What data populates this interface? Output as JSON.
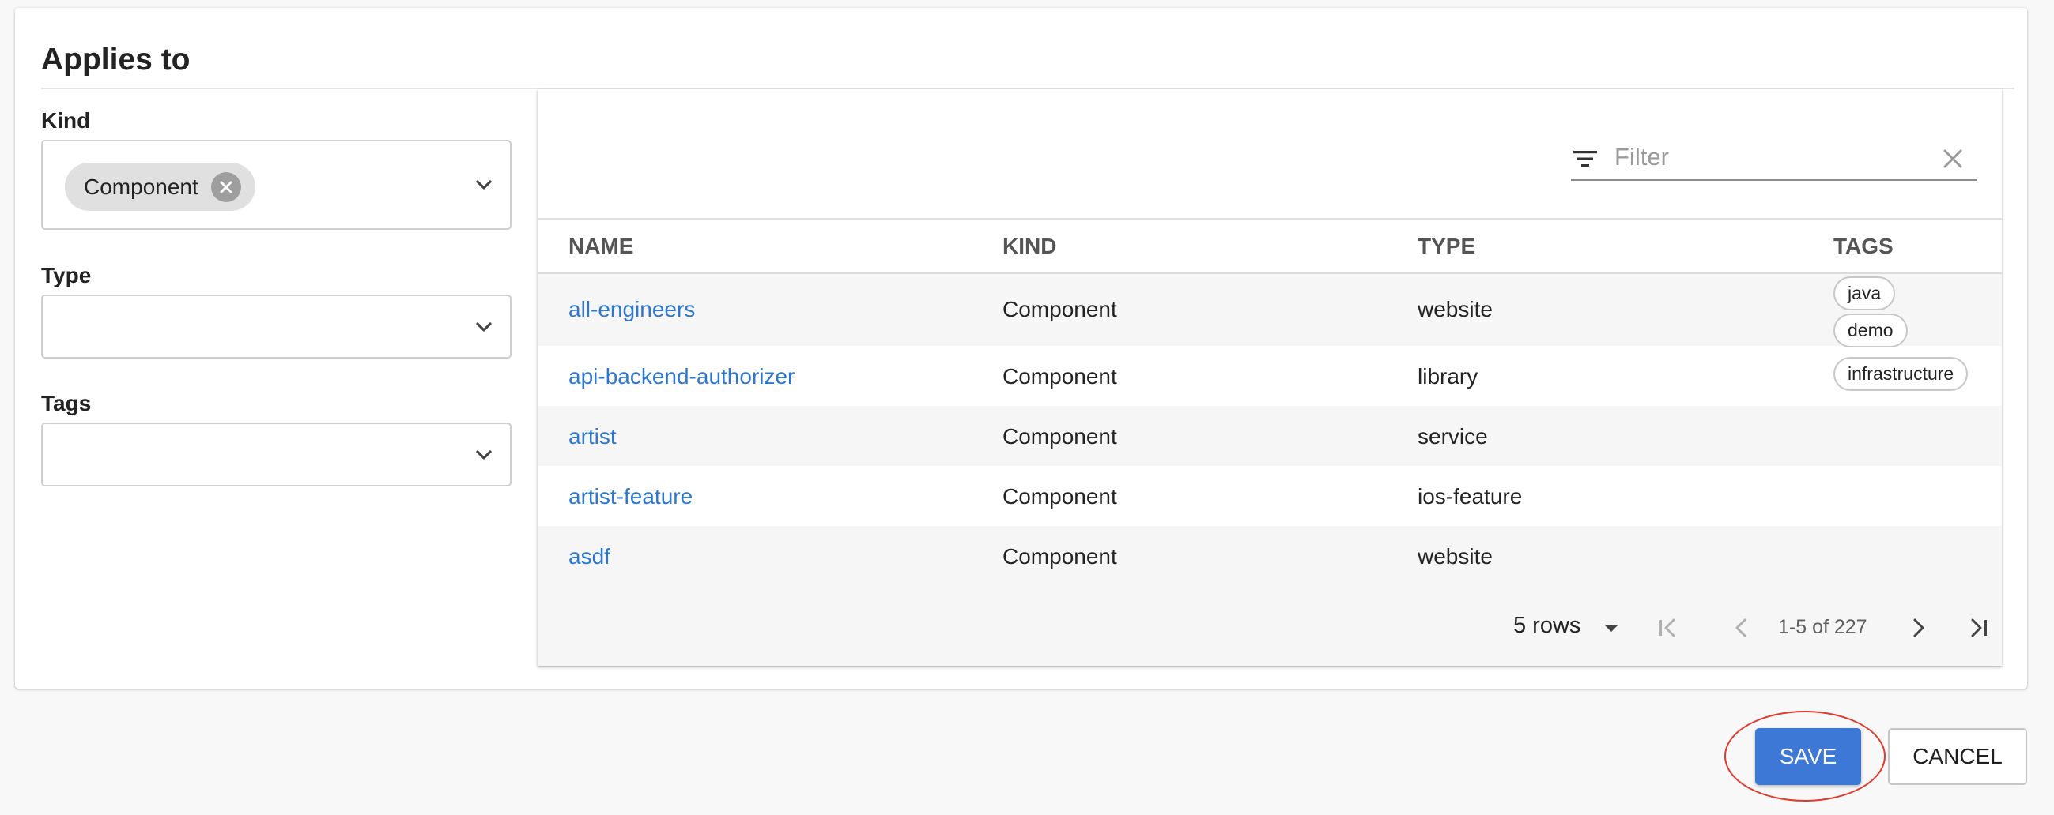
{
  "card": {
    "title": "Applies to"
  },
  "filters": {
    "kind": {
      "label": "Kind",
      "chip": "Component"
    },
    "type": {
      "label": "Type"
    },
    "tags": {
      "label": "Tags"
    }
  },
  "table": {
    "search": {
      "placeholder": "Filter",
      "value": ""
    },
    "columns": [
      "NAME",
      "KIND",
      "TYPE",
      "TAGS"
    ],
    "rows": [
      {
        "name": "all-engineers",
        "kind": "Component",
        "type": "website",
        "tags": [
          "java",
          "demo"
        ]
      },
      {
        "name": "api-backend-authorizer",
        "kind": "Component",
        "type": "library",
        "tags": [
          "infrastructure"
        ]
      },
      {
        "name": "artist",
        "kind": "Component",
        "type": "service",
        "tags": []
      },
      {
        "name": "artist-feature",
        "kind": "Component",
        "type": "ios-feature",
        "tags": []
      },
      {
        "name": "asdf",
        "kind": "Component",
        "type": "website",
        "tags": []
      }
    ],
    "pagination": {
      "rows_per_page": "5 rows",
      "range": "1-5 of 227"
    }
  },
  "actions": {
    "save": "SAVE",
    "cancel": "CANCEL"
  },
  "colors": {
    "accent": "#3d78d6",
    "link": "#2e77d0",
    "highlight_ring": "#e03a2e"
  },
  "icons": {
    "chip_remove": "close-circle-icon",
    "select_caret": "chevron-down-icon",
    "filter": "filter-list-icon",
    "clear": "close-icon",
    "first_page": "first-page-icon",
    "prev_page": "chevron-left-icon",
    "next_page": "chevron-right-icon",
    "last_page": "last-page-icon"
  }
}
